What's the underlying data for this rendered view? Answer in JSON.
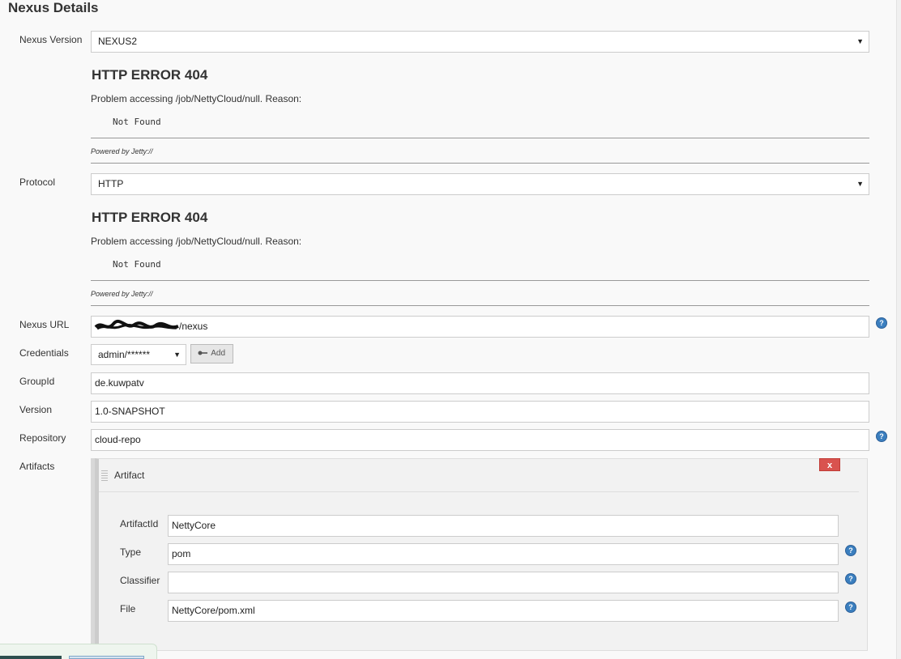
{
  "page": {
    "title": "Nexus Details"
  },
  "nexus_version": {
    "label": "Nexus Version",
    "value": "NEXUS2"
  },
  "protocol": {
    "label": "Protocol",
    "value": "HTTP"
  },
  "error_block": {
    "title": "HTTP ERROR 404",
    "message": "Problem accessing /job/NettyCloud/null. Reason:",
    "reason": "Not Found",
    "powered_by": "Powered by Jetty://"
  },
  "nexus_url": {
    "label": "Nexus URL",
    "value": "/nexus"
  },
  "credentials": {
    "label": "Credentials",
    "value": "admin/******",
    "add_label": "Add"
  },
  "group_id": {
    "label": "GroupId",
    "value": "de.kuwpatv"
  },
  "version": {
    "label": "Version",
    "value": "1.0-SNAPSHOT"
  },
  "repository": {
    "label": "Repository",
    "value": "cloud-repo"
  },
  "artifacts": {
    "label": "Artifacts",
    "section_title": "Artifact",
    "delete_label": "x",
    "artifact_id": {
      "label": "ArtifactId",
      "value": "NettyCore"
    },
    "type": {
      "label": "Type",
      "value": "pom"
    },
    "classifier": {
      "label": "Classifier",
      "value": ""
    },
    "file": {
      "label": "File",
      "value": "NettyCore/pom.xml"
    }
  },
  "icons": {
    "help": "help-icon",
    "key": "key-icon",
    "drag": "drag-handle-icon"
  },
  "colors": {
    "help_icon": "#3b7fbf",
    "delete_button": "#d9534f"
  }
}
